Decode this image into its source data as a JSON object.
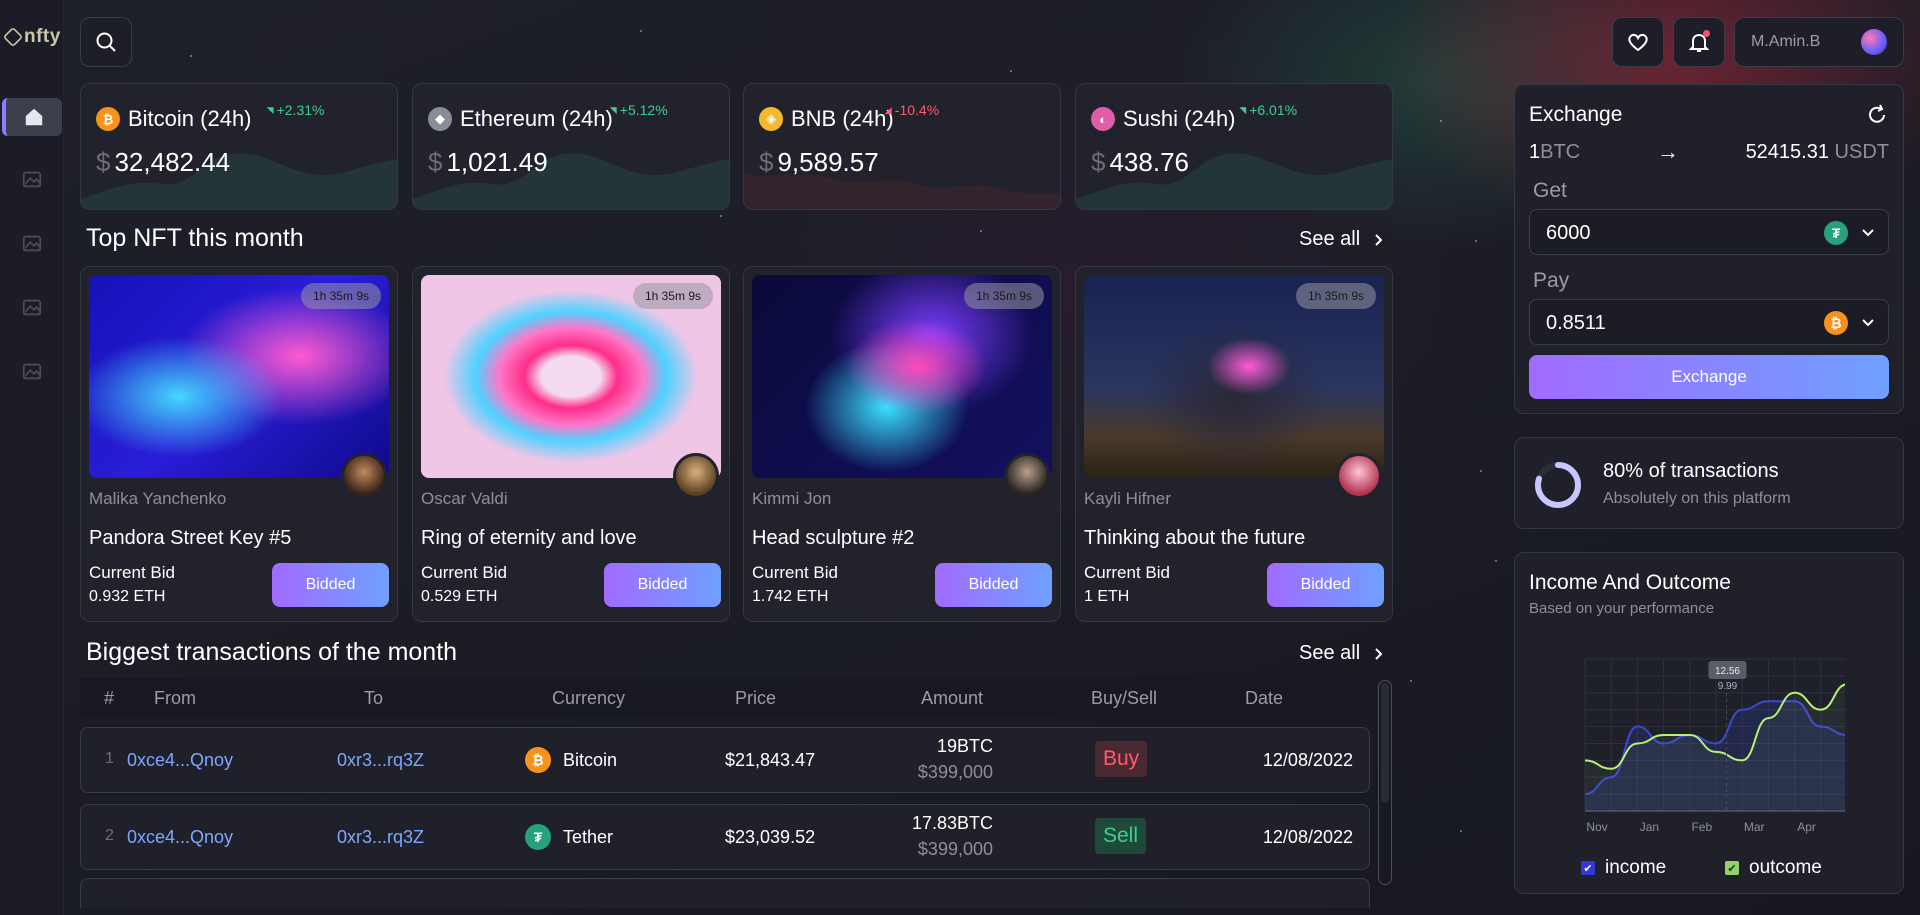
{
  "app": {
    "logo_text": "nfty"
  },
  "topbar": {
    "user_name": "M.Amin.B"
  },
  "sidebar": {
    "items": [
      "home",
      "gallery-1",
      "gallery-2",
      "gallery-3",
      "gallery-4"
    ]
  },
  "coins": [
    {
      "name": "Bitcoin (24h)",
      "change": "+2.31%",
      "price": "32,482.44",
      "currency": "$",
      "color": "#f7931a",
      "glyph": "₿",
      "trend": "up"
    },
    {
      "name": "Ethereum (24h)",
      "change": "+5.12%",
      "price": "1,021.49",
      "currency": "$",
      "color": "#8a8c96",
      "glyph": "◆",
      "trend": "up"
    },
    {
      "name": "BNB (24h)",
      "change": "-10.4%",
      "price": "9,589.57",
      "currency": "$",
      "color": "#f3ba2f",
      "glyph": "◈",
      "trend": "down"
    },
    {
      "name": "Sushi (24h)",
      "change": "+6.01%",
      "price": "438.76",
      "currency": "$",
      "color": "#e05daa",
      "glyph": "◐",
      "trend": "up"
    }
  ],
  "nft_section": {
    "title": "Top NFT this month",
    "see_all": "See all"
  },
  "nfts": [
    {
      "timer": "1h 35m 9s",
      "artist": "Malika Yanchenko",
      "title": "Pandora Street Key #5",
      "bid_label": "Current Bid",
      "bid": "0.932 ETH",
      "button": "Bidded"
    },
    {
      "timer": "1h 35m 9s",
      "artist": "Oscar Valdi",
      "title": "Ring of eternity and love",
      "bid_label": "Current Bid",
      "bid": "0.529 ETH",
      "button": "Bidded"
    },
    {
      "timer": "1h 35m 9s",
      "artist": "Kimmi Jon",
      "title": "Head sculpture #2",
      "bid_label": "Current Bid",
      "bid": "1.742 ETH",
      "button": "Bidded"
    },
    {
      "timer": "1h 35m 9s",
      "artist": "Kayli Hifner",
      "title": "Thinking about the future",
      "bid_label": "Current Bid",
      "bid": "1 ETH",
      "button": "Bidded"
    }
  ],
  "tx_section": {
    "title": "Biggest transactions of the month",
    "see_all": "See all"
  },
  "tx_table": {
    "columns": [
      "#",
      "From",
      "To",
      "Currency",
      "Price",
      "Amount",
      "Buy/Sell",
      "Date"
    ],
    "rows": [
      {
        "num": "1",
        "from": "0xce4...Qnoy",
        "to": "0xr3...rq3Z",
        "currency": "Bitcoin",
        "currency_glyph": "₿",
        "currency_color": "#f7931a",
        "price": "$21,843.47",
        "amount": "19BTC",
        "amount_usd": "$399,000",
        "side": "Buy",
        "date": "12/08/2022"
      },
      {
        "num": "2",
        "from": "0xce4...Qnoy",
        "to": "0xr3...rq3Z",
        "currency": "Tether",
        "currency_glyph": "₮",
        "currency_color": "#26a17b",
        "price": "$23,039.52",
        "amount": "17.83BTC",
        "amount_usd": "$399,000",
        "side": "Sell",
        "date": "12/08/2022"
      }
    ]
  },
  "exchange": {
    "title": "Exchange",
    "rate_from_amount": "1",
    "rate_from_unit": "BTC",
    "rate_arrow": "→",
    "rate_to_amount": "52415.31",
    "rate_to_unit": "USDT",
    "get_label": "Get",
    "get_value": "6000",
    "pay_label": "Pay",
    "pay_value": "0.8511",
    "button": "Exchange"
  },
  "transactions_stat": {
    "percent": 80,
    "title": "80% of transactions",
    "subtitle": "Absolutely on this platform"
  },
  "income_panel": {
    "title": "Income And Outcome",
    "subtitle": "Based on your performance",
    "tooltip_top": "12.56",
    "tooltip_bottom": "9.99",
    "legend_income": "income",
    "legend_outcome": "outcome"
  },
  "chart_data": {
    "type": "line",
    "categories": [
      "Nov",
      "Jan",
      "Feb",
      "Mar",
      "Apr"
    ],
    "x": [
      0,
      0.5,
      1,
      1.5,
      2,
      2.5,
      3,
      3.5,
      4,
      4.5,
      5
    ],
    "series": [
      {
        "name": "income",
        "color": "#3a48d8",
        "values": [
          2,
          4,
          10,
          8,
          9,
          8,
          12,
          13,
          13,
          10,
          9
        ]
      },
      {
        "name": "outcome",
        "color": "#b6f07a",
        "values": [
          6,
          5,
          8,
          9,
          9,
          7,
          6,
          11,
          14,
          12,
          15
        ]
      }
    ],
    "ylim": [
      0,
      18
    ],
    "grid": true,
    "legend": "bottom"
  }
}
